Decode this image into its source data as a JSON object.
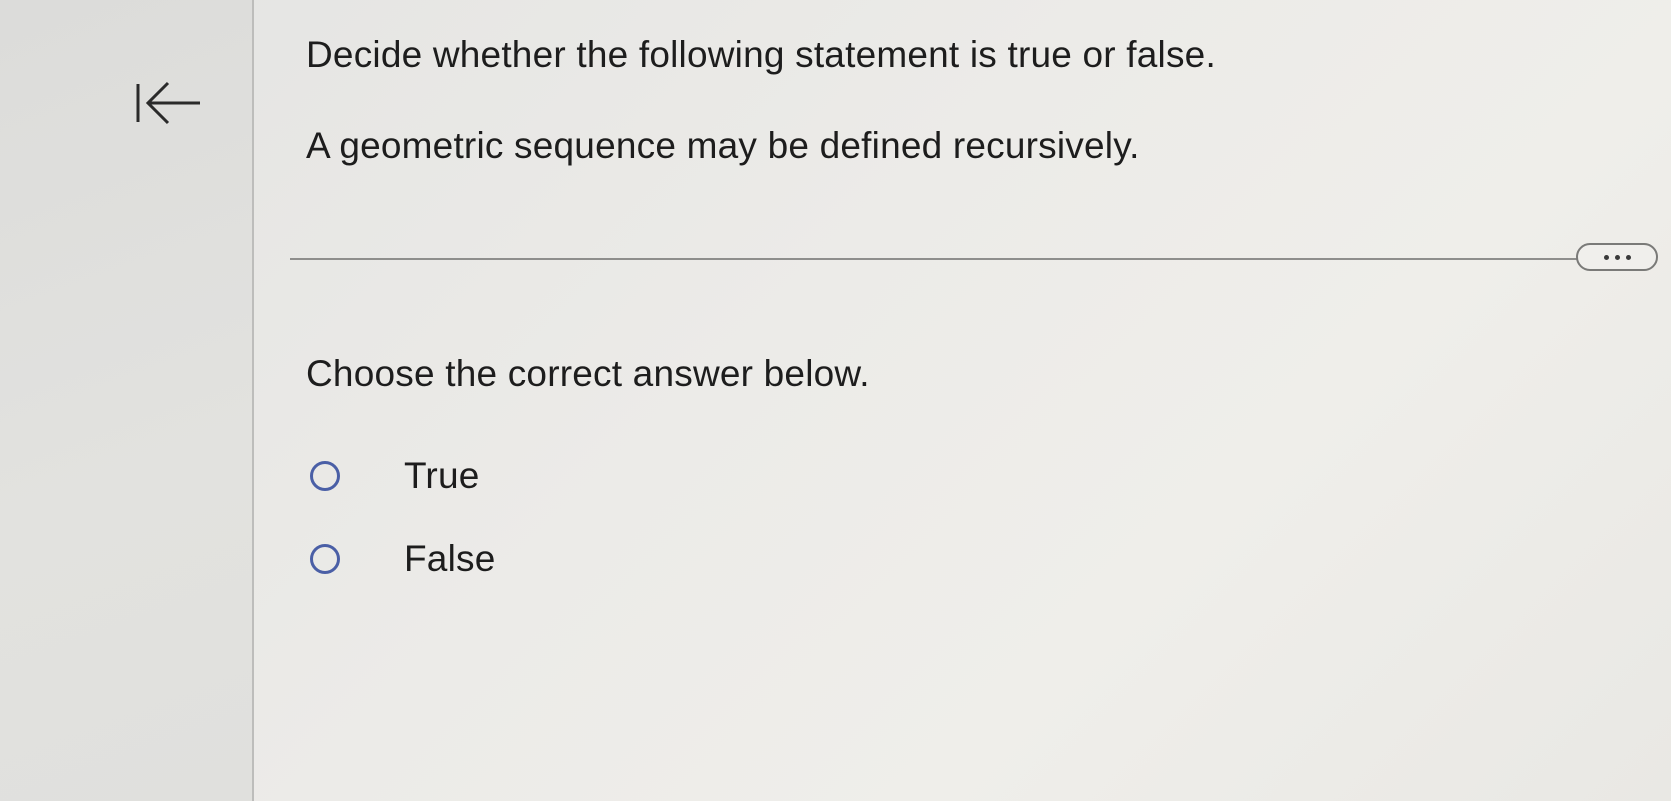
{
  "sidebar": {
    "collapse_icon": "collapse-left-arrow-icon"
  },
  "question": {
    "title": "Decide whether the following statement is true or false.",
    "statement": "A geometric sequence may be defined recursively.",
    "more_icon": "ellipsis-icon",
    "prompt": "Choose the correct answer below.",
    "options": [
      {
        "label": "True",
        "selected": false
      },
      {
        "label": "False",
        "selected": false
      }
    ]
  },
  "colors": {
    "radio_border": "#4a5fa6",
    "text": "#1d1d1d",
    "divider": "#8e8e8c"
  }
}
